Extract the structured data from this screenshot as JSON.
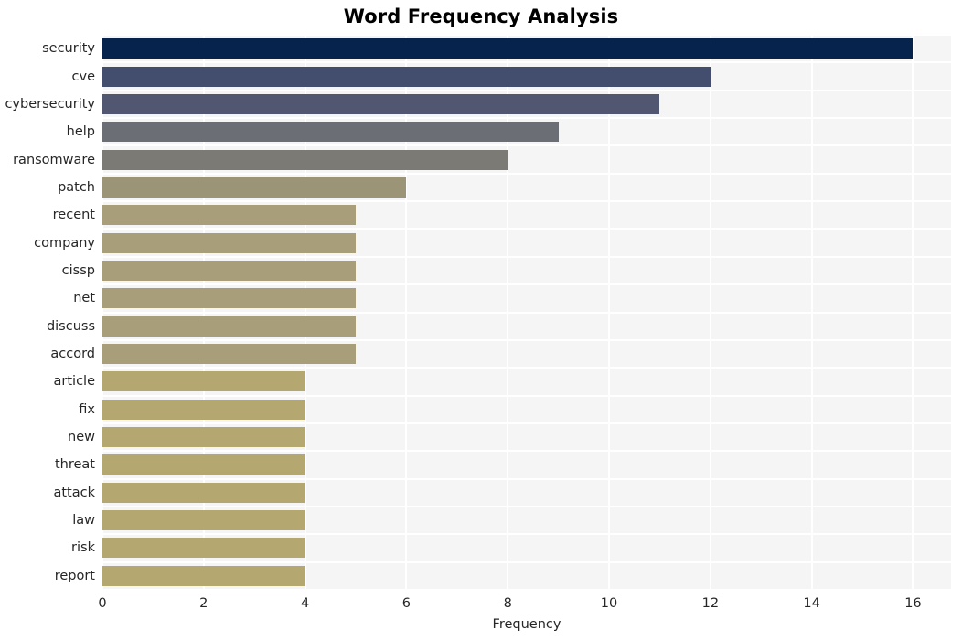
{
  "chart_data": {
    "type": "bar",
    "orientation": "horizontal",
    "title": "Word Frequency Analysis",
    "xlabel": "Frequency",
    "ylabel": "",
    "categories": [
      "security",
      "cve",
      "cybersecurity",
      "help",
      "ransomware",
      "patch",
      "recent",
      "company",
      "cissp",
      "net",
      "discuss",
      "accord",
      "article",
      "fix",
      "new",
      "threat",
      "attack",
      "law",
      "risk",
      "report"
    ],
    "values": [
      16,
      12,
      11,
      9,
      8,
      6,
      5,
      5,
      5,
      5,
      5,
      5,
      4,
      4,
      4,
      4,
      4,
      4,
      4,
      4
    ],
    "bar_colors": [
      "#05234d",
      "#434e6e",
      "#525771",
      "#6c6e75",
      "#7b7a74",
      "#9c9477",
      "#a89e79",
      "#a89e79",
      "#a89e79",
      "#a89e79",
      "#a89e79",
      "#a89e79",
      "#b5a770",
      "#b5a770",
      "#b5a770",
      "#b5a770",
      "#b5a770",
      "#b5a770",
      "#b5a770",
      "#b5a770"
    ],
    "xlim": [
      0,
      16.75
    ],
    "xticks": [
      0,
      2,
      4,
      6,
      8,
      10,
      12,
      14,
      16
    ],
    "xtick_labels": [
      "0",
      "2",
      "4",
      "6",
      "8",
      "10",
      "12",
      "14",
      "16"
    ],
    "grid": true,
    "grid_color": "#ffffff",
    "plot_background": "#f5f5f5",
    "figure_background": "#ffffff",
    "legend": null,
    "annotations": []
  }
}
